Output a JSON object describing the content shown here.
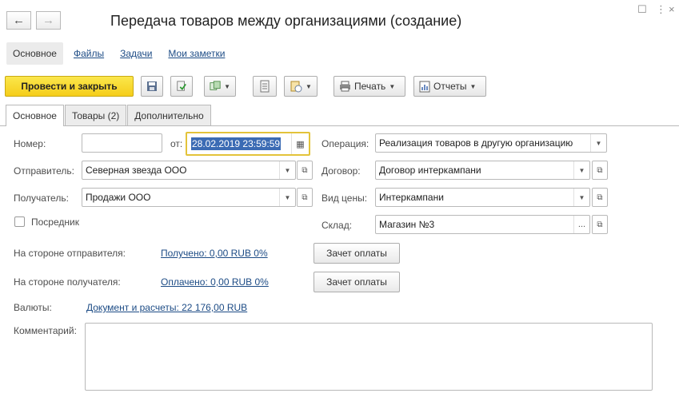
{
  "window": {
    "title": "Передача товаров между организациями (создание)",
    "back_icon": "arrow-left-icon",
    "forward_icon": "arrow-right-icon"
  },
  "nav_panel": {
    "active": "Основное",
    "links": [
      "Файлы",
      "Задачи",
      "Мои заметки"
    ]
  },
  "toolbar": {
    "post_close_label": "Провести и закрыть",
    "print_label": "Печать",
    "reports_label": "Отчеты"
  },
  "tabs": [
    "Основное",
    "Товары (2)",
    "Дополнительно"
  ],
  "form": {
    "number_label": "Номер:",
    "number_value": "",
    "date_label": "от:",
    "date_value": "28.02.2019 23:59:59",
    "sender_label": "Отправитель:",
    "sender_value": "Северная звезда ООО",
    "receiver_label": "Получатель:",
    "receiver_value": "Продажи ООО",
    "intermediary_label": "Посредник",
    "intermediary_checked": false,
    "operation_label": "Операция:",
    "operation_value": "Реализация товаров в другую организацию",
    "contract_label": "Договор:",
    "contract_value": "Договор интеркампани",
    "price_type_label": "Вид цены:",
    "price_type_value": "Интеркампани",
    "warehouse_label": "Склад:",
    "warehouse_value": "Магазин №3",
    "sender_side_label": "На стороне отправителя:",
    "sender_side_link": "Получено: 0,00 RUB  0%",
    "receiver_side_label": "На стороне получателя:",
    "receiver_side_link": "Оплачено: 0,00 RUB  0%",
    "offset_button_label": "Зачет оплаты",
    "currency_label": "Валюты:",
    "currency_link": "Документ и расчеты: 22 176,00 RUB",
    "comment_label": "Комментарий:",
    "comment_value": ""
  },
  "colors": {
    "primary_button": "#f5cd1a",
    "link": "#1c4b85",
    "focus_border": "#e3c33a",
    "selection": "#3b6bb4"
  }
}
